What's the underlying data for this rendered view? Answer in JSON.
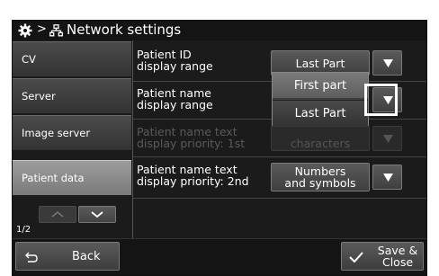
{
  "header": {
    "breadcrumb_sep": ">",
    "title": "Network settings",
    "icons": [
      "gear-icon",
      "network-icon"
    ]
  },
  "sidebar": {
    "items": [
      {
        "label": "CV",
        "active": false
      },
      {
        "label": "Server",
        "active": false
      },
      {
        "label": "Image server",
        "active": false
      },
      {
        "label": "Patient data",
        "active": true
      }
    ],
    "page_indicator": "1/2",
    "icons": [
      "chevron-up-icon",
      "chevron-down-icon"
    ]
  },
  "settings": [
    {
      "label": "Patient ID\ndisplay range",
      "value": "Last Part",
      "enabled": true
    },
    {
      "label": "Patient name\ndisplay range",
      "value": "",
      "enabled": true
    },
    {
      "label": "Patient name text\ndisplay priority: 1st",
      "value": "characters",
      "enabled": false
    },
    {
      "label": "Patient name text\ndisplay priority: 2nd",
      "value": "Numbers\nand symbols",
      "enabled": true
    }
  ],
  "dropdown": {
    "options": [
      "First part",
      "Last Part"
    ],
    "highlighted": "First part"
  },
  "footer": {
    "back_label": "Back",
    "save_label": "Save &\nClose",
    "icons": [
      "return-icon",
      "checkmark-icon"
    ]
  },
  "colors": {
    "background": "#1b1b1b",
    "button": "#4a4a4a",
    "active_tab": "#8a8a8a",
    "highlight_frame": "#ffffff",
    "text": "#ffffff"
  }
}
